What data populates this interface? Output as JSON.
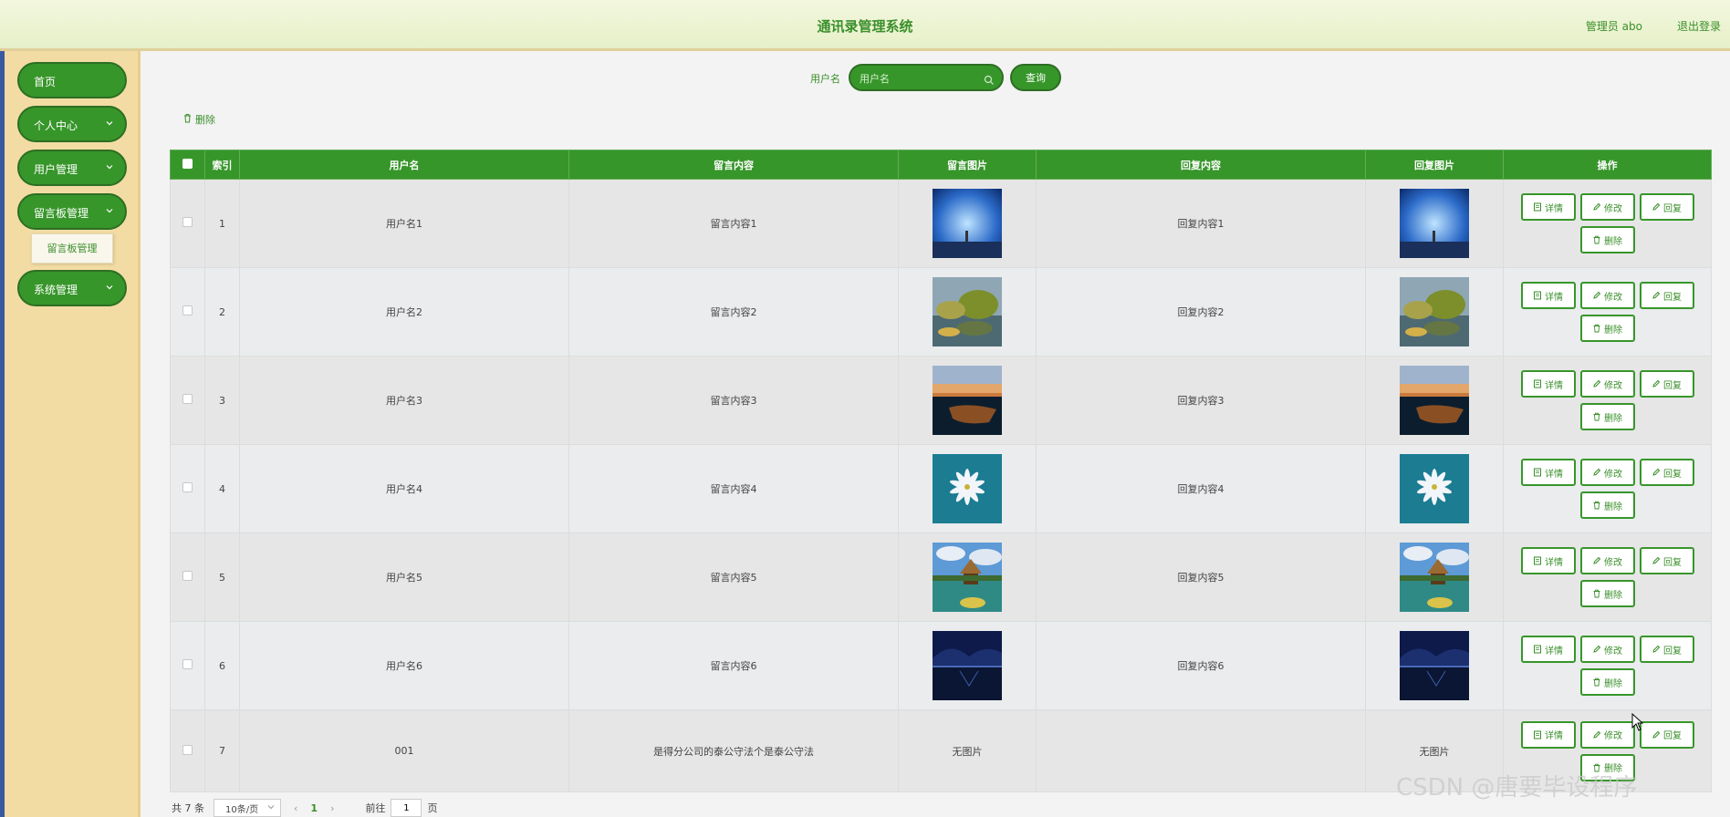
{
  "header": {
    "title": "通讯录管理系统",
    "admin": "管理员 abo",
    "logout": "退出登录"
  },
  "sidebar": {
    "items": [
      {
        "label": "首页"
      },
      {
        "label": "个人中心"
      },
      {
        "label": "用户管理"
      },
      {
        "label": "留言板管理"
      },
      {
        "label": "系统管理"
      }
    ],
    "submenu": "留言板管理"
  },
  "search": {
    "label": "用户名",
    "placeholder": "用户名",
    "button": "查询"
  },
  "toolbar": {
    "delete": "删除"
  },
  "table": {
    "headers": [
      "索引",
      "用户名",
      "留言内容",
      "留言图片",
      "回复内容",
      "回复图片",
      "操作"
    ],
    "rows": [
      {
        "index": "1",
        "username": "用户名1",
        "content": "留言内容1",
        "reply": "回复内容1",
        "image": "blue-sky-figure"
      },
      {
        "index": "2",
        "username": "用户名2",
        "content": "留言内容2",
        "reply": "回复内容2",
        "image": "tree-reflection"
      },
      {
        "index": "3",
        "username": "用户名3",
        "content": "留言内容3",
        "reply": "回复内容3",
        "image": "sunset-boat"
      },
      {
        "index": "4",
        "username": "用户名4",
        "content": "留言内容4",
        "reply": "回复内容4",
        "image": "white-flower"
      },
      {
        "index": "5",
        "username": "用户名5",
        "content": "留言内容5",
        "reply": "回复内容5",
        "image": "pavilion-lake"
      },
      {
        "index": "6",
        "username": "用户名6",
        "content": "留言内容6",
        "reply": "回复内容6",
        "image": "night-lake"
      },
      {
        "index": "7",
        "username": "001",
        "content": "是得分公司的泰公守法个是泰公守法",
        "reply": "",
        "no_image": "无图片"
      }
    ],
    "ops": {
      "detail": "详情",
      "edit": "修改",
      "reply": "回复",
      "delete": "删除"
    }
  },
  "pager": {
    "total": "共 7 条",
    "size": "10条/页",
    "prev": "‹",
    "current": "1",
    "next": "›",
    "goto": "前往",
    "page": "1",
    "suffix": "页"
  },
  "watermark": "CSDN @唐要毕设程序",
  "colors": {
    "primary": "#37962a",
    "sidebar": "#f2dca3",
    "header": "#eaf2d0"
  }
}
